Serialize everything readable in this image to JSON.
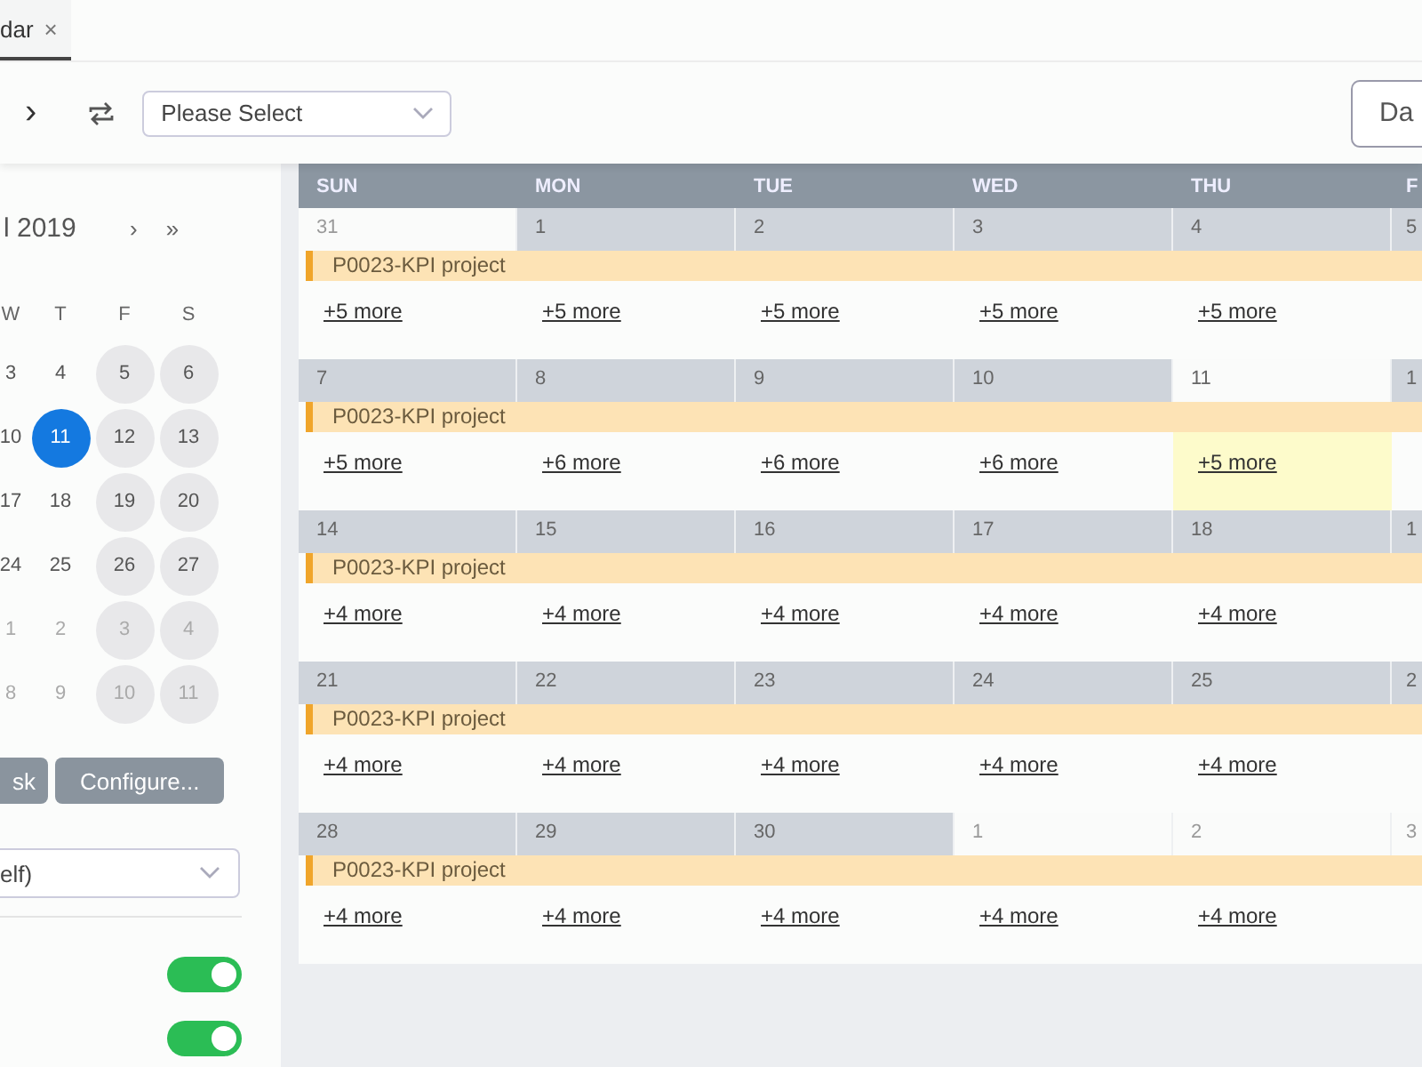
{
  "tab": {
    "label": "dar",
    "close": "×",
    "selected": true
  },
  "toolbar": {
    "next": "›",
    "select": {
      "placeholder": "Please Select"
    },
    "view_button": "Da"
  },
  "mini_calendar": {
    "title": "l 2019",
    "next": "›",
    "next_year": "»",
    "weekdays": [
      "W",
      "T",
      "F",
      "S"
    ],
    "weeks": [
      [
        {
          "day": "3",
          "weekend": false,
          "outside": false,
          "selected": false
        },
        {
          "day": "4",
          "weekend": false,
          "outside": false,
          "selected": false
        },
        {
          "day": "5",
          "weekend": true,
          "outside": false,
          "selected": false
        },
        {
          "day": "6",
          "weekend": true,
          "outside": false,
          "selected": false
        }
      ],
      [
        {
          "day": "10",
          "weekend": false,
          "outside": false,
          "selected": false
        },
        {
          "day": "11",
          "weekend": false,
          "outside": false,
          "selected": true
        },
        {
          "day": "12",
          "weekend": true,
          "outside": false,
          "selected": false
        },
        {
          "day": "13",
          "weekend": true,
          "outside": false,
          "selected": false
        }
      ],
      [
        {
          "day": "17",
          "weekend": false,
          "outside": false,
          "selected": false
        },
        {
          "day": "18",
          "weekend": false,
          "outside": false,
          "selected": false
        },
        {
          "day": "19",
          "weekend": true,
          "outside": false,
          "selected": false
        },
        {
          "day": "20",
          "weekend": true,
          "outside": false,
          "selected": false
        }
      ],
      [
        {
          "day": "24",
          "weekend": false,
          "outside": false,
          "selected": false
        },
        {
          "day": "25",
          "weekend": false,
          "outside": false,
          "selected": false
        },
        {
          "day": "26",
          "weekend": true,
          "outside": false,
          "selected": false
        },
        {
          "day": "27",
          "weekend": true,
          "outside": false,
          "selected": false
        }
      ],
      [
        {
          "day": "1",
          "weekend": false,
          "outside": true,
          "selected": false
        },
        {
          "day": "2",
          "weekend": false,
          "outside": true,
          "selected": false
        },
        {
          "day": "3",
          "weekend": true,
          "outside": true,
          "selected": false
        },
        {
          "day": "4",
          "weekend": true,
          "outside": true,
          "selected": false
        }
      ],
      [
        {
          "day": "8",
          "weekend": false,
          "outside": true,
          "selected": false
        },
        {
          "day": "9",
          "weekend": false,
          "outside": true,
          "selected": false
        },
        {
          "day": "10",
          "weekend": true,
          "outside": true,
          "selected": false
        },
        {
          "day": "11",
          "weekend": true,
          "outside": true,
          "selected": false
        }
      ]
    ]
  },
  "buttons": [
    "sk",
    "Configure..."
  ],
  "filter_select": {
    "value": "elf)"
  },
  "toggles": [
    {
      "on": true
    },
    {
      "on": true
    }
  ],
  "calendar": {
    "headers": [
      "SUN",
      "MON",
      "TUE",
      "WED",
      "THU",
      "F"
    ],
    "weeks": [
      {
        "event": "P0023-KPI project",
        "days": [
          {
            "date": "31",
            "outside": true,
            "today": false,
            "more": "+5 more"
          },
          {
            "date": "1",
            "outside": false,
            "today": false,
            "more": "+5 more"
          },
          {
            "date": "2",
            "outside": false,
            "today": false,
            "more": "+5 more"
          },
          {
            "date": "3",
            "outside": false,
            "today": false,
            "more": "+5 more"
          },
          {
            "date": "4",
            "outside": false,
            "today": false,
            "more": "+5 more"
          },
          {
            "date": "5",
            "outside": false,
            "today": false
          }
        ]
      },
      {
        "event": "P0023-KPI project",
        "days": [
          {
            "date": "7",
            "outside": false,
            "today": false,
            "more": "+5 more"
          },
          {
            "date": "8",
            "outside": false,
            "today": false,
            "more": "+6 more"
          },
          {
            "date": "9",
            "outside": false,
            "today": false,
            "more": "+6 more"
          },
          {
            "date": "10",
            "outside": false,
            "today": false,
            "more": "+6 more"
          },
          {
            "date": "11",
            "outside": false,
            "today": true,
            "more": "+5 more"
          },
          {
            "date": "1",
            "outside": false,
            "today": false
          }
        ]
      },
      {
        "event": "P0023-KPI project",
        "days": [
          {
            "date": "14",
            "outside": false,
            "today": false,
            "more": "+4 more"
          },
          {
            "date": "15",
            "outside": false,
            "today": false,
            "more": "+4 more"
          },
          {
            "date": "16",
            "outside": false,
            "today": false,
            "more": "+4 more"
          },
          {
            "date": "17",
            "outside": false,
            "today": false,
            "more": "+4 more"
          },
          {
            "date": "18",
            "outside": false,
            "today": false,
            "more": "+4 more"
          },
          {
            "date": "1",
            "outside": false,
            "today": false
          }
        ]
      },
      {
        "event": "P0023-KPI project",
        "days": [
          {
            "date": "21",
            "outside": false,
            "today": false,
            "more": "+4 more"
          },
          {
            "date": "22",
            "outside": false,
            "today": false,
            "more": "+4 more"
          },
          {
            "date": "23",
            "outside": false,
            "today": false,
            "more": "+4 more"
          },
          {
            "date": "24",
            "outside": false,
            "today": false,
            "more": "+4 more"
          },
          {
            "date": "25",
            "outside": false,
            "today": false,
            "more": "+4 more"
          },
          {
            "date": "2",
            "outside": false,
            "today": false
          }
        ]
      },
      {
        "event": "P0023-KPI project",
        "days": [
          {
            "date": "28",
            "outside": false,
            "today": false,
            "more": "+4 more"
          },
          {
            "date": "29",
            "outside": false,
            "today": false,
            "more": "+4 more"
          },
          {
            "date": "30",
            "outside": false,
            "today": false,
            "more": "+4 more"
          },
          {
            "date": "1",
            "outside": true,
            "today": false,
            "more": "+4 more"
          },
          {
            "date": "2",
            "outside": true,
            "today": false,
            "more": "+4 more"
          },
          {
            "date": "3",
            "outside": true,
            "today": false
          }
        ]
      }
    ]
  }
}
